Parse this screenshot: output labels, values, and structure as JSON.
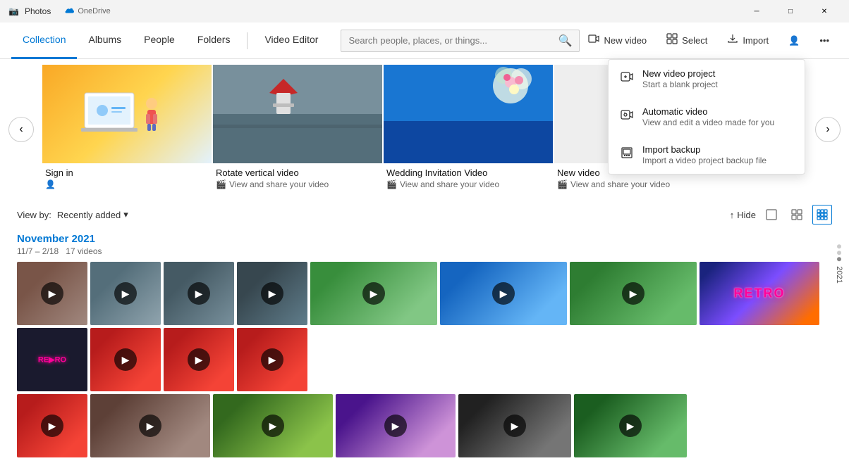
{
  "app": {
    "title": "Photos"
  },
  "titlebar": {
    "onedrive_label": "OneDrive",
    "minimize": "─",
    "maximize": "□",
    "close": "✕"
  },
  "nav": {
    "tabs": [
      {
        "id": "collection",
        "label": "Collection",
        "active": true
      },
      {
        "id": "albums",
        "label": "Albums",
        "active": false
      },
      {
        "id": "people",
        "label": "People",
        "active": false
      },
      {
        "id": "folders",
        "label": "Folders",
        "active": false
      },
      {
        "id": "video-editor",
        "label": "Video Editor",
        "active": false
      }
    ],
    "search_placeholder": "Search people, places, or things...",
    "new_video_label": "New video",
    "select_label": "Select",
    "import_label": "Import"
  },
  "video_strip": {
    "cards": [
      {
        "id": "signin",
        "title": "Sign in",
        "subtitle": "",
        "has_sub_icon": true,
        "type": "signin"
      },
      {
        "id": "rotate",
        "title": "Rotate vertical video",
        "subtitle": "View and share your video",
        "has_sub_icon": true,
        "type": "rotate"
      },
      {
        "id": "wedding",
        "title": "Wedding Invitation Video",
        "subtitle": "View and share your video",
        "has_sub_icon": true,
        "type": "wedding"
      },
      {
        "id": "newvideo",
        "title": "New video",
        "subtitle": "View and share your video",
        "has_sub_icon": true,
        "type": "newvideo"
      }
    ]
  },
  "collection": {
    "view_by_label": "View by:",
    "view_by_option": "Recently added",
    "hide_label": "Hide",
    "month_label": "November 2021",
    "date_range": "11/7 – 2/18",
    "video_count": "17 videos"
  },
  "dropdown": {
    "items": [
      {
        "id": "new-project",
        "title": "New video project",
        "desc": "Start a blank project",
        "icon": "🎬"
      },
      {
        "id": "automatic",
        "title": "Automatic video",
        "desc": "View and edit a video made for you",
        "icon": "🎞"
      },
      {
        "id": "import-backup",
        "title": "Import backup",
        "desc": "Import a video project backup file",
        "icon": "💾"
      }
    ]
  },
  "year_indicator": {
    "year": "2021"
  }
}
